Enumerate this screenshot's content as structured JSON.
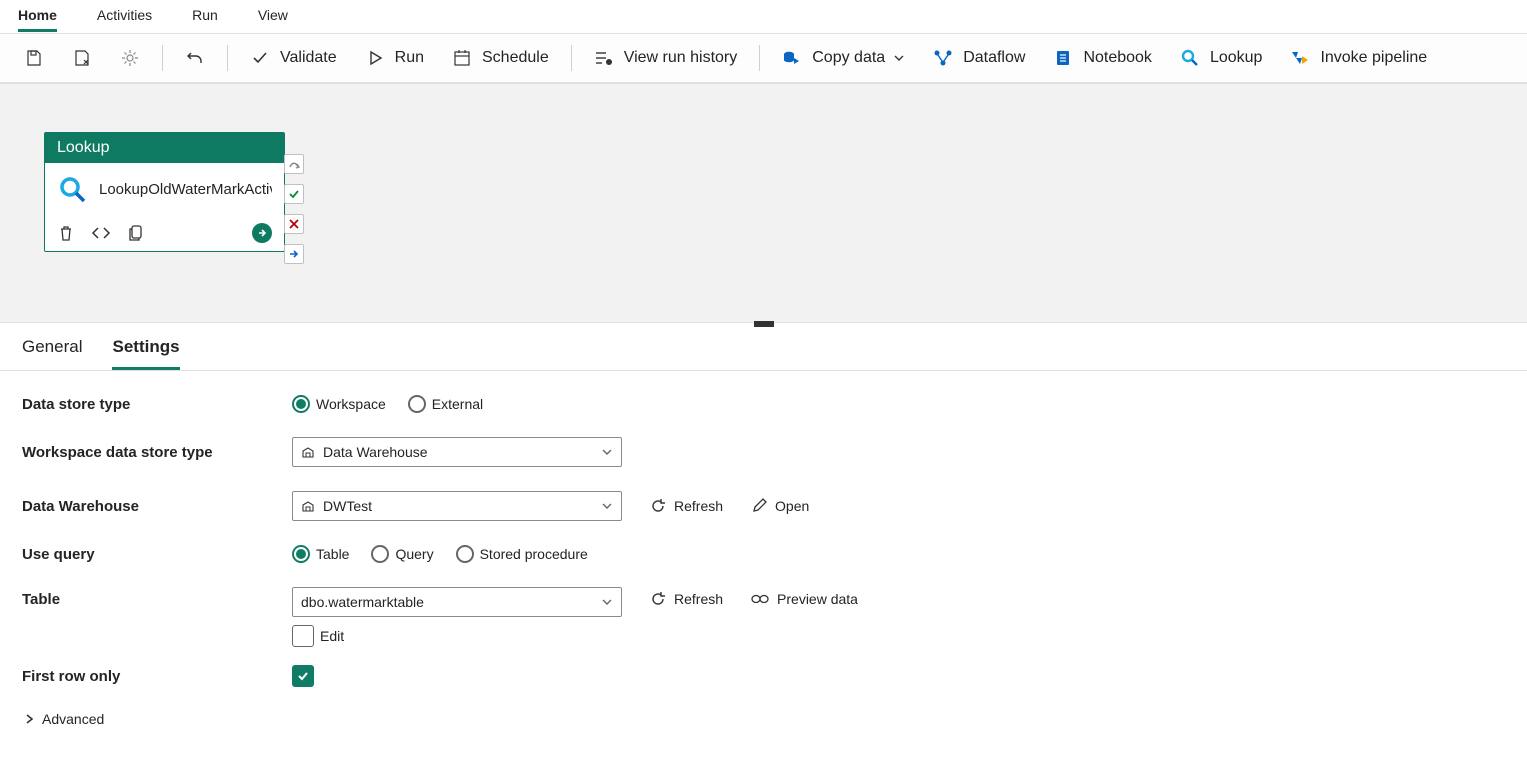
{
  "topTabs": {
    "home": "Home",
    "activities": "Activities",
    "run": "Run",
    "view": "View"
  },
  "toolbar": {
    "validate": "Validate",
    "run": "Run",
    "schedule": "Schedule",
    "viewRunHistory": "View run history",
    "copyData": "Copy data",
    "dataflow": "Dataflow",
    "notebook": "Notebook",
    "lookup": "Lookup",
    "invokePipeline": "Invoke pipeline"
  },
  "activity": {
    "type": "Lookup",
    "name": "LookupOldWaterMarkActivity"
  },
  "panelTabs": {
    "general": "General",
    "settings": "Settings"
  },
  "settings": {
    "labels": {
      "dataStoreType": "Data store type",
      "workspaceDataStoreType": "Workspace data store type",
      "dataWarehouse": "Data Warehouse",
      "useQuery": "Use query",
      "table": "Table",
      "firstRowOnly": "First row only",
      "advanced": "Advanced"
    },
    "dataStoreType": {
      "workspace": "Workspace",
      "external": "External"
    },
    "workspaceDataStoreType": "Data Warehouse",
    "dataWarehouse": "DWTest",
    "refresh": "Refresh",
    "open": "Open",
    "previewData": "Preview data",
    "useQuery": {
      "table": "Table",
      "query": "Query",
      "storedProcedure": "Stored procedure"
    },
    "table": "dbo.watermarktable",
    "edit": "Edit"
  }
}
